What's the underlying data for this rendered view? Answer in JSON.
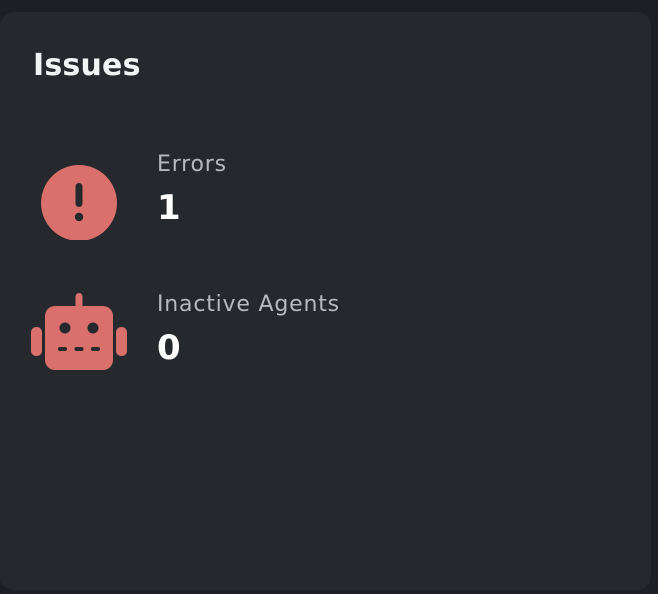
{
  "card": {
    "title": "Issues"
  },
  "issues": [
    {
      "label": "Errors",
      "value": "1",
      "icon": "exclamation-circle-icon"
    },
    {
      "label": "Inactive Agents",
      "value": "0",
      "icon": "robot-icon"
    }
  ],
  "colors": {
    "background": "#1c1f23",
    "card": "#25282d",
    "icon_accent": "#d9706b",
    "title": "#f2f3f5",
    "label": "#b6b9be",
    "value": "#ffffff"
  }
}
